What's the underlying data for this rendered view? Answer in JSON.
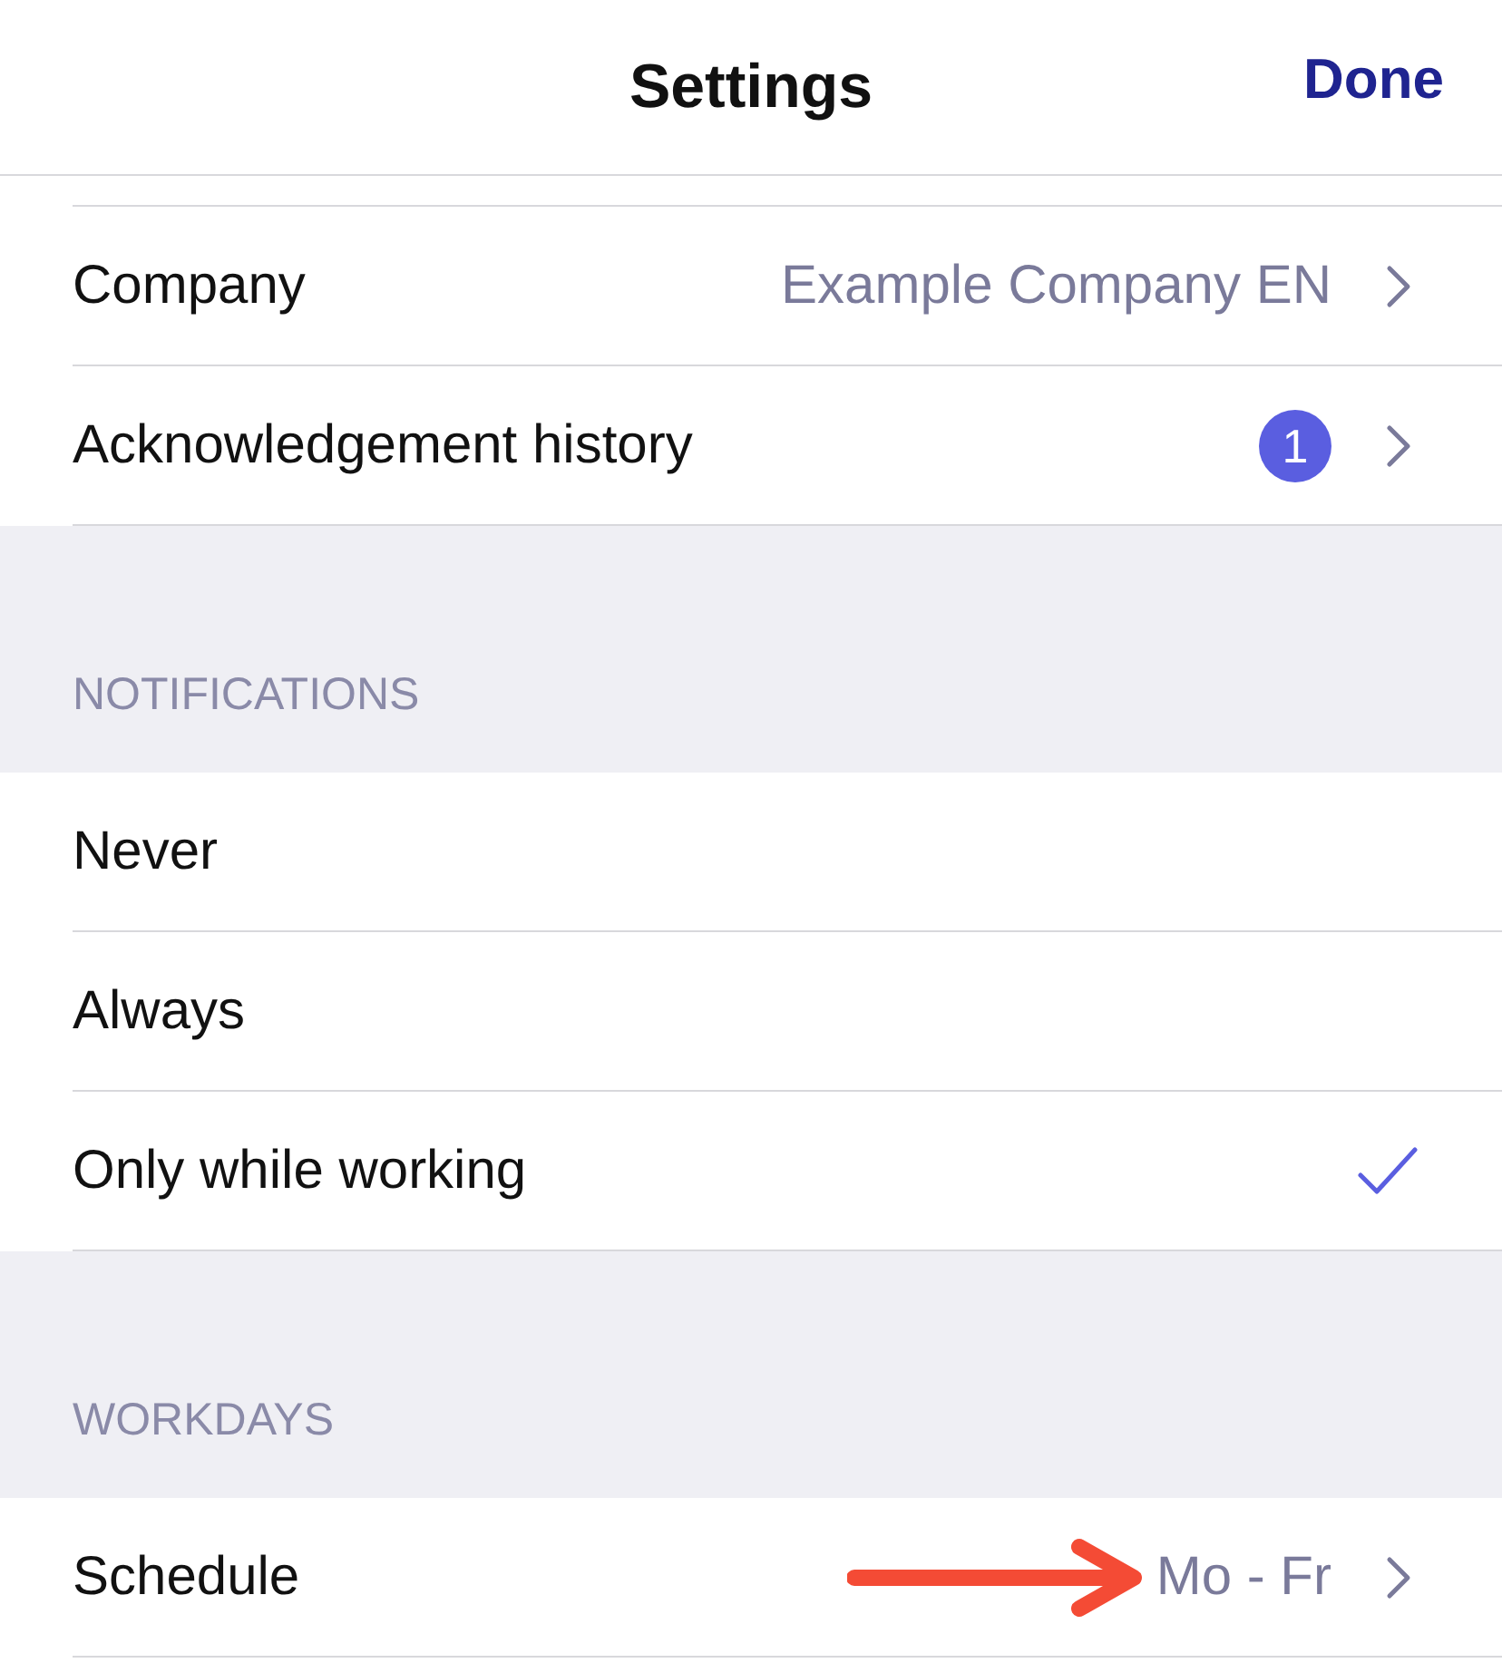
{
  "nav": {
    "title": "Settings",
    "done": "Done"
  },
  "sections": [
    {
      "rows": [
        {
          "kind": "link",
          "label": "Company",
          "value": "Example Company EN",
          "annotated": false
        },
        {
          "kind": "badge",
          "label": "Acknowledgement history",
          "badge": "1"
        }
      ]
    },
    {
      "header": "NOTIFICATIONS",
      "rows": [
        {
          "kind": "option",
          "label": "Never",
          "selected": false
        },
        {
          "kind": "option",
          "label": "Always",
          "selected": false
        },
        {
          "kind": "option",
          "label": "Only while working",
          "selected": true
        }
      ]
    },
    {
      "header": "WORKDAYS",
      "rows": [
        {
          "kind": "link",
          "label": "Schedule",
          "value": "Mo - Fr",
          "annotated": true
        }
      ]
    }
  ]
}
